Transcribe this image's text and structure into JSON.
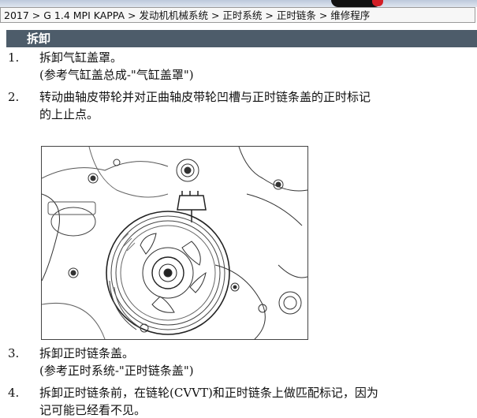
{
  "breadcrumb": "2017 > G 1.4 MPI KAPPA > 发动机机械系统 > 正时系统 > 正时链条 > 维修程序",
  "section_title": "拆卸",
  "steps": [
    {
      "num": "1.",
      "text": "拆卸气缸盖罩。",
      "ref": "(参考气缸盖总成-\"气缸盖罩\")"
    },
    {
      "num": "2.",
      "text": "转动曲轴皮带轮并对正曲轴皮带轮凹槽与正时链条盖的正时标记",
      "cont": "的上止点。"
    },
    {
      "num": "3.",
      "text": "拆卸正时链条盖。",
      "ref": "(参考正时系统-\"正时链条盖\")"
    },
    {
      "num": "4.",
      "text": "拆卸正时链条前，在链轮(CVVT)和正时链条上做匹配标记，因为",
      "cont": "记可能已经看不见。"
    }
  ],
  "colors": {
    "section_bar": "#4d5c6a",
    "logo_red": "#d21f26"
  }
}
